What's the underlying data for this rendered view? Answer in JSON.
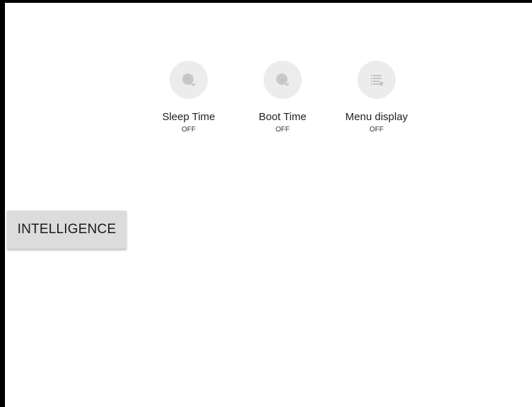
{
  "tiles": [
    {
      "label": "Sleep Time",
      "value": "OFF",
      "icon": "clock-icon"
    },
    {
      "label": "Boot Time",
      "value": "OFF",
      "icon": "clock-icon"
    },
    {
      "label": "Menu display",
      "value": "OFF",
      "icon": "list-icon"
    }
  ],
  "intelligence_button": {
    "label": "INTELLIGENCE"
  },
  "colors": {
    "background": "#ffffff",
    "frame_border": "#000000",
    "icon_circle": "#ececec",
    "icon_glyph": "#c4c4c4",
    "button_bg": "#dcdcdc"
  }
}
